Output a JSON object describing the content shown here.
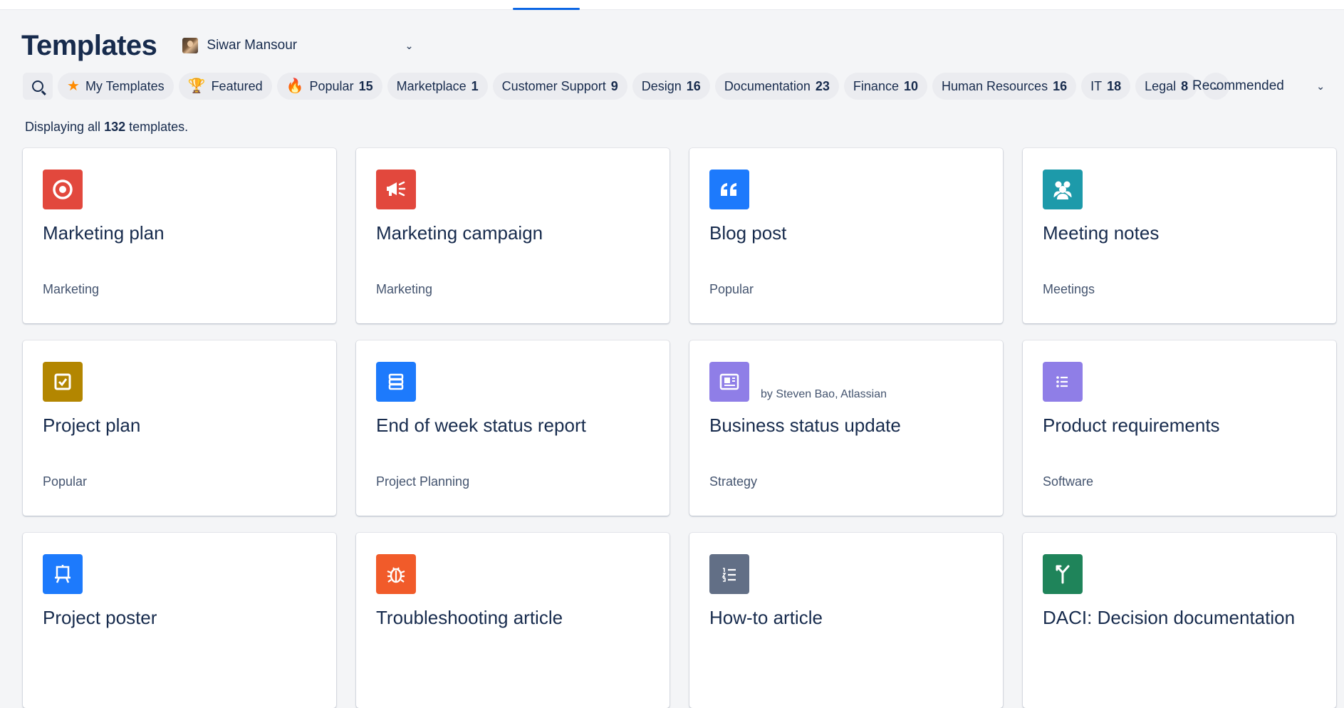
{
  "header": {
    "title": "Templates",
    "space_name": "Siwar Mansour"
  },
  "filters": [
    {
      "label": "My Templates",
      "count": "",
      "icon": "star-icon"
    },
    {
      "label": "Featured",
      "count": "",
      "icon": "trophy-icon"
    },
    {
      "label": "Popular",
      "count": "15",
      "icon": "fire-icon"
    },
    {
      "label": "Marketplace",
      "count": "1",
      "icon": ""
    },
    {
      "label": "Customer Support",
      "count": "9",
      "icon": ""
    },
    {
      "label": "Design",
      "count": "16",
      "icon": ""
    },
    {
      "label": "Documentation",
      "count": "23",
      "icon": ""
    },
    {
      "label": "Finance",
      "count": "10",
      "icon": ""
    },
    {
      "label": "Human Resources",
      "count": "16",
      "icon": ""
    },
    {
      "label": "IT",
      "count": "18",
      "icon": ""
    },
    {
      "label": "Legal",
      "count": "8",
      "icon": ""
    }
  ],
  "sort": {
    "label": "Recommended"
  },
  "summary": {
    "prefix": "Displaying all",
    "count": "132",
    "suffix": "templates."
  },
  "cards": [
    {
      "name": "Marketing plan",
      "category": "Marketing",
      "author": "",
      "icon": "target-icon",
      "color": "#e2483d"
    },
    {
      "name": "Marketing campaign",
      "category": "Marketing",
      "author": "",
      "icon": "megaphone-icon",
      "color": "#e2483d"
    },
    {
      "name": "Blog post",
      "category": "Popular",
      "author": "",
      "icon": "quote-icon",
      "color": "#1d7afc"
    },
    {
      "name": "Meeting notes",
      "category": "Meetings",
      "author": "",
      "icon": "people-icon",
      "color": "#1d9aaa"
    },
    {
      "name": "Project plan",
      "category": "Popular",
      "author": "",
      "icon": "checkbox-icon",
      "color": "#b38600"
    },
    {
      "name": "End of week status report",
      "category": "Project Planning",
      "author": "",
      "icon": "stack-icon",
      "color": "#1d7afc"
    },
    {
      "name": "Business status update",
      "category": "Strategy",
      "author": "by Steven Bao, Atlassian",
      "icon": "newspaper-icon",
      "color": "#8f7ee7"
    },
    {
      "name": "Product requirements",
      "category": "Software",
      "author": "",
      "icon": "list-icon",
      "color": "#8f7ee7"
    },
    {
      "name": "Project poster",
      "category": "",
      "author": "",
      "icon": "easel-icon",
      "color": "#1d7afc"
    },
    {
      "name": "Troubleshooting article",
      "category": "",
      "author": "",
      "icon": "bug-icon",
      "color": "#f15b2a"
    },
    {
      "name": "How-to article",
      "category": "",
      "author": "",
      "icon": "numbered-list-icon",
      "color": "#626f86"
    },
    {
      "name": "DACI: Decision documentation",
      "category": "",
      "author": "",
      "icon": "fork-icon",
      "color": "#1f845a"
    }
  ]
}
